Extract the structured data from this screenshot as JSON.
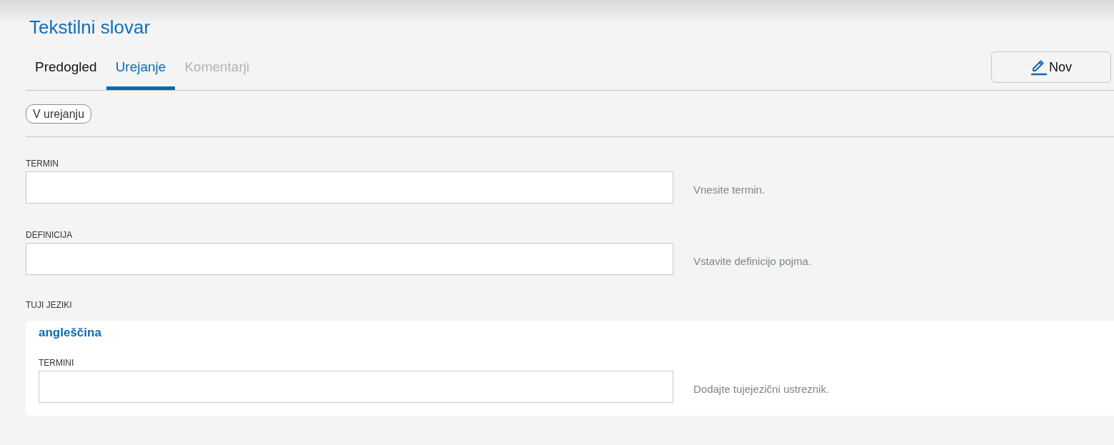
{
  "page": {
    "title": "Tekstilni slovar"
  },
  "tabs": [
    {
      "label": "Predogled",
      "selected": false,
      "disabled": false
    },
    {
      "label": "Urejanje",
      "selected": true,
      "disabled": false
    },
    {
      "label": "Komentarji",
      "selected": false,
      "disabled": true
    }
  ],
  "new_button": {
    "label": "Nov"
  },
  "status_badge": {
    "label": "V urejanju"
  },
  "fields": [
    {
      "label": "TERMIN",
      "hint": "Vnesite termin."
    },
    {
      "label": "DEFINICIJA",
      "hint": "Vstavite definicijo pojma."
    }
  ],
  "foreign_languages": {
    "label": "TUJI JEZIKI",
    "languages": [
      {
        "name": "angleščina",
        "fields": [
          {
            "label": "TERMINI",
            "hint": "Dodajte tujejezični ustreznik."
          }
        ]
      }
    ]
  }
}
